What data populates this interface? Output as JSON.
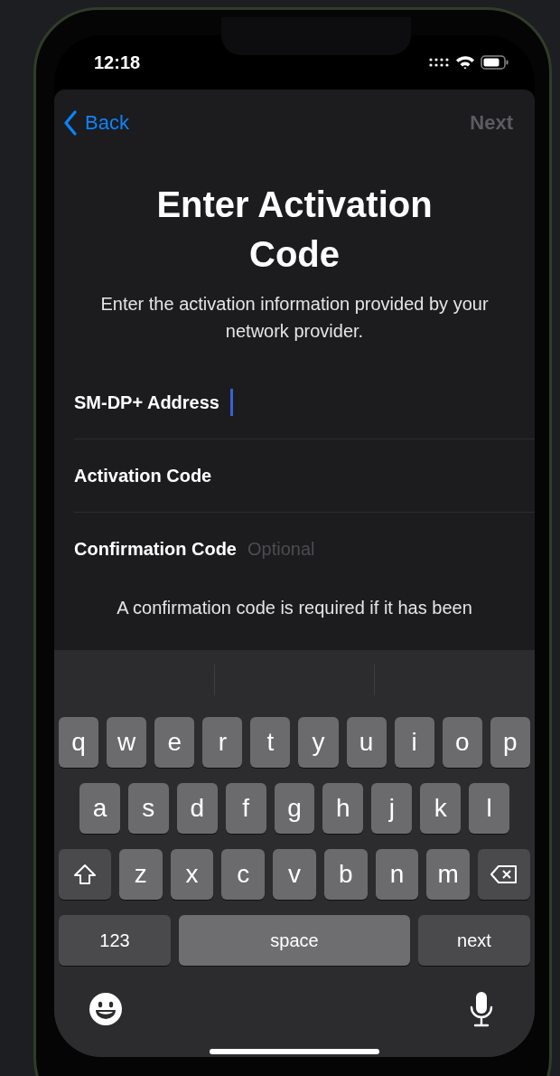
{
  "status_bar": {
    "time": "12:18"
  },
  "nav": {
    "back": "Back",
    "next": {
      "label": "Next",
      "disabled": true
    }
  },
  "title": "Enter Activation Code",
  "subtitle": "Enter the activation information provided by your network provider.",
  "fields": [
    {
      "label": "SM-DP+ Address",
      "focused": true
    },
    {
      "label": "Activation Code",
      "focused": false
    },
    {
      "label": "Confirmation Code",
      "placeholder": "Optional",
      "focused": false
    }
  ],
  "note": "A confirmation code is required if it has been",
  "keyboard": {
    "rows": [
      {
        "keys": [
          {
            "kind": "letter",
            "label": "q"
          },
          {
            "kind": "letter",
            "label": "w"
          },
          {
            "kind": "letter",
            "label": "e"
          },
          {
            "kind": "letter",
            "label": "r"
          },
          {
            "kind": "letter",
            "label": "t"
          },
          {
            "kind": "letter",
            "label": "y"
          },
          {
            "kind": "letter",
            "label": "u"
          },
          {
            "kind": "letter",
            "label": "i"
          },
          {
            "kind": "letter",
            "label": "o"
          },
          {
            "kind": "letter",
            "label": "p"
          }
        ]
      },
      {
        "keys": [
          {
            "kind": "letter",
            "label": "a"
          },
          {
            "kind": "letter",
            "label": "s"
          },
          {
            "kind": "letter",
            "label": "d"
          },
          {
            "kind": "letter",
            "label": "f"
          },
          {
            "kind": "letter",
            "label": "g"
          },
          {
            "kind": "letter",
            "label": "h"
          },
          {
            "kind": "letter",
            "label": "j"
          },
          {
            "kind": "letter",
            "label": "k"
          },
          {
            "kind": "letter",
            "label": "l"
          }
        ]
      },
      {
        "keys": [
          {
            "kind": "shift"
          },
          {
            "kind": "letter",
            "label": "z"
          },
          {
            "kind": "letter",
            "label": "x"
          },
          {
            "kind": "letter",
            "label": "c"
          },
          {
            "kind": "letter",
            "label": "v"
          },
          {
            "kind": "letter",
            "label": "b"
          },
          {
            "kind": "letter",
            "label": "n"
          },
          {
            "kind": "letter",
            "label": "m"
          },
          {
            "kind": "delete"
          }
        ]
      },
      {
        "keys": [
          {
            "kind": "mode",
            "label": "123"
          },
          {
            "kind": "space",
            "label": "space"
          },
          {
            "kind": "return",
            "label": "next"
          }
        ]
      }
    ]
  }
}
